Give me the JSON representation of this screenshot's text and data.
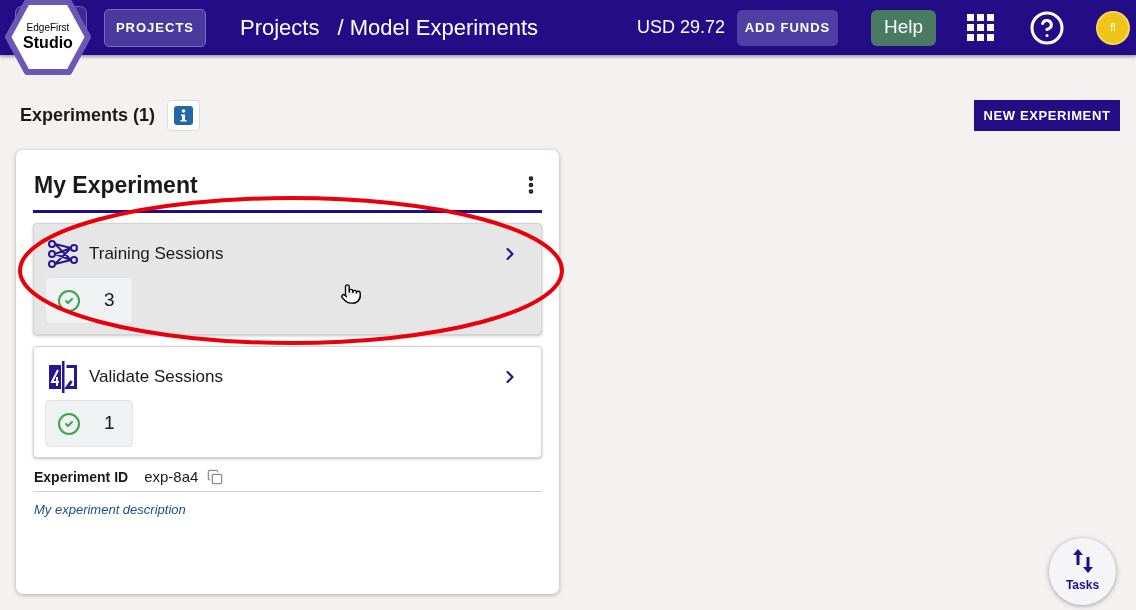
{
  "header": {
    "logo": {
      "line_1": "EdgeFirst",
      "line_2": "Studio"
    },
    "nav_button": "PROJECTS",
    "breadcrumb": [
      "Projects",
      "/ Model Experiments"
    ],
    "balance": "USD 29.72",
    "add_funds_button": "ADD FUNDS",
    "help_button": "Help",
    "avatar_initials": "fl"
  },
  "page": {
    "heading": "Experiments (1)",
    "new_button": "NEW EXPERIMENT",
    "experiments": [
      {
        "title": "My Experiment",
        "sessions": [
          {
            "kind": "training",
            "title": "Training Sessions",
            "count": "3",
            "hovered": true
          },
          {
            "kind": "validate",
            "title": "Validate Sessions",
            "count": "1",
            "hovered": false
          }
        ],
        "id_label": "Experiment ID",
        "id_value": "exp-8a4",
        "description": "My experiment description"
      }
    ]
  },
  "tasks_button": {
    "label": "Tasks"
  },
  "annotation": {
    "kind": "ellipse"
  }
}
